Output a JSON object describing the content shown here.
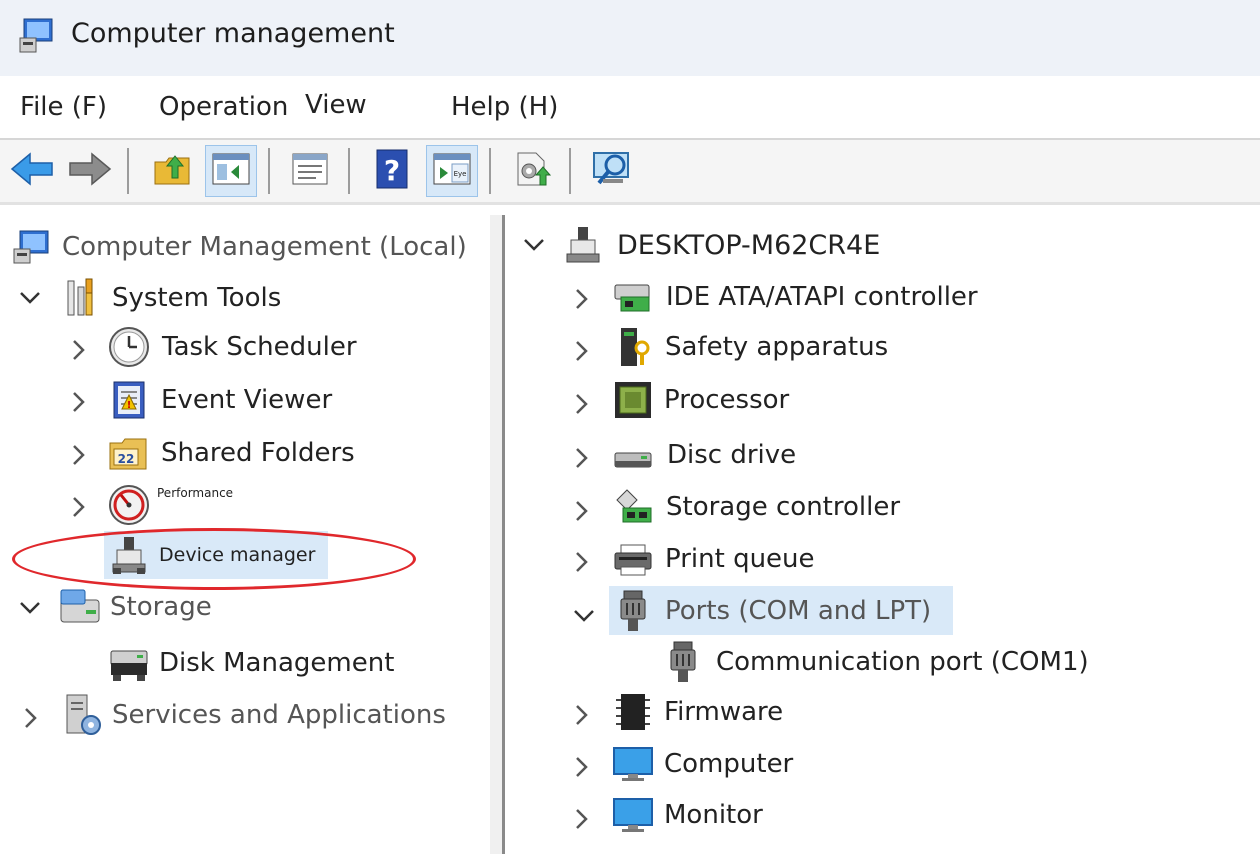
{
  "window": {
    "title": "Computer management"
  },
  "menu": {
    "file": "File (F)",
    "operation": "Operation",
    "view": "View",
    "help": "Help (H)"
  },
  "toolbar": {
    "buttons": [
      "back-arrow-icon",
      "forward-arrow-icon",
      "up-folder-icon",
      "show-hide-tree-icon",
      "properties-icon",
      "help-icon",
      "action-pane-icon",
      "export-icon",
      "scan-hardware-icon"
    ],
    "eye_badge": "Eye"
  },
  "tree": {
    "root": "Computer Management (Local)",
    "system_tools": "System Tools",
    "task_scheduler": "Task Scheduler",
    "event_viewer": "Event Viewer",
    "shared_folders": "Shared Folders",
    "shared_badge": "22",
    "performance": "Performance",
    "device_manager": "Device manager",
    "storage": "Storage",
    "disk_management": "Disk Management",
    "services": "Services and Applications"
  },
  "devices": {
    "root": "DESKTOP-M62CR4E",
    "items": [
      "IDE ATA/ATAPI controller",
      "Safety apparatus",
      "Processor",
      "Disc drive",
      "Storage controller",
      "Print queue",
      "Ports (COM and LPT)",
      "Communication port (COM1)",
      "Firmware",
      "Computer",
      "Monitor"
    ]
  },
  "colors": {
    "accent": "#d9e9f8",
    "annotation": "#e0282c",
    "titlebar": "#eef2f8"
  }
}
